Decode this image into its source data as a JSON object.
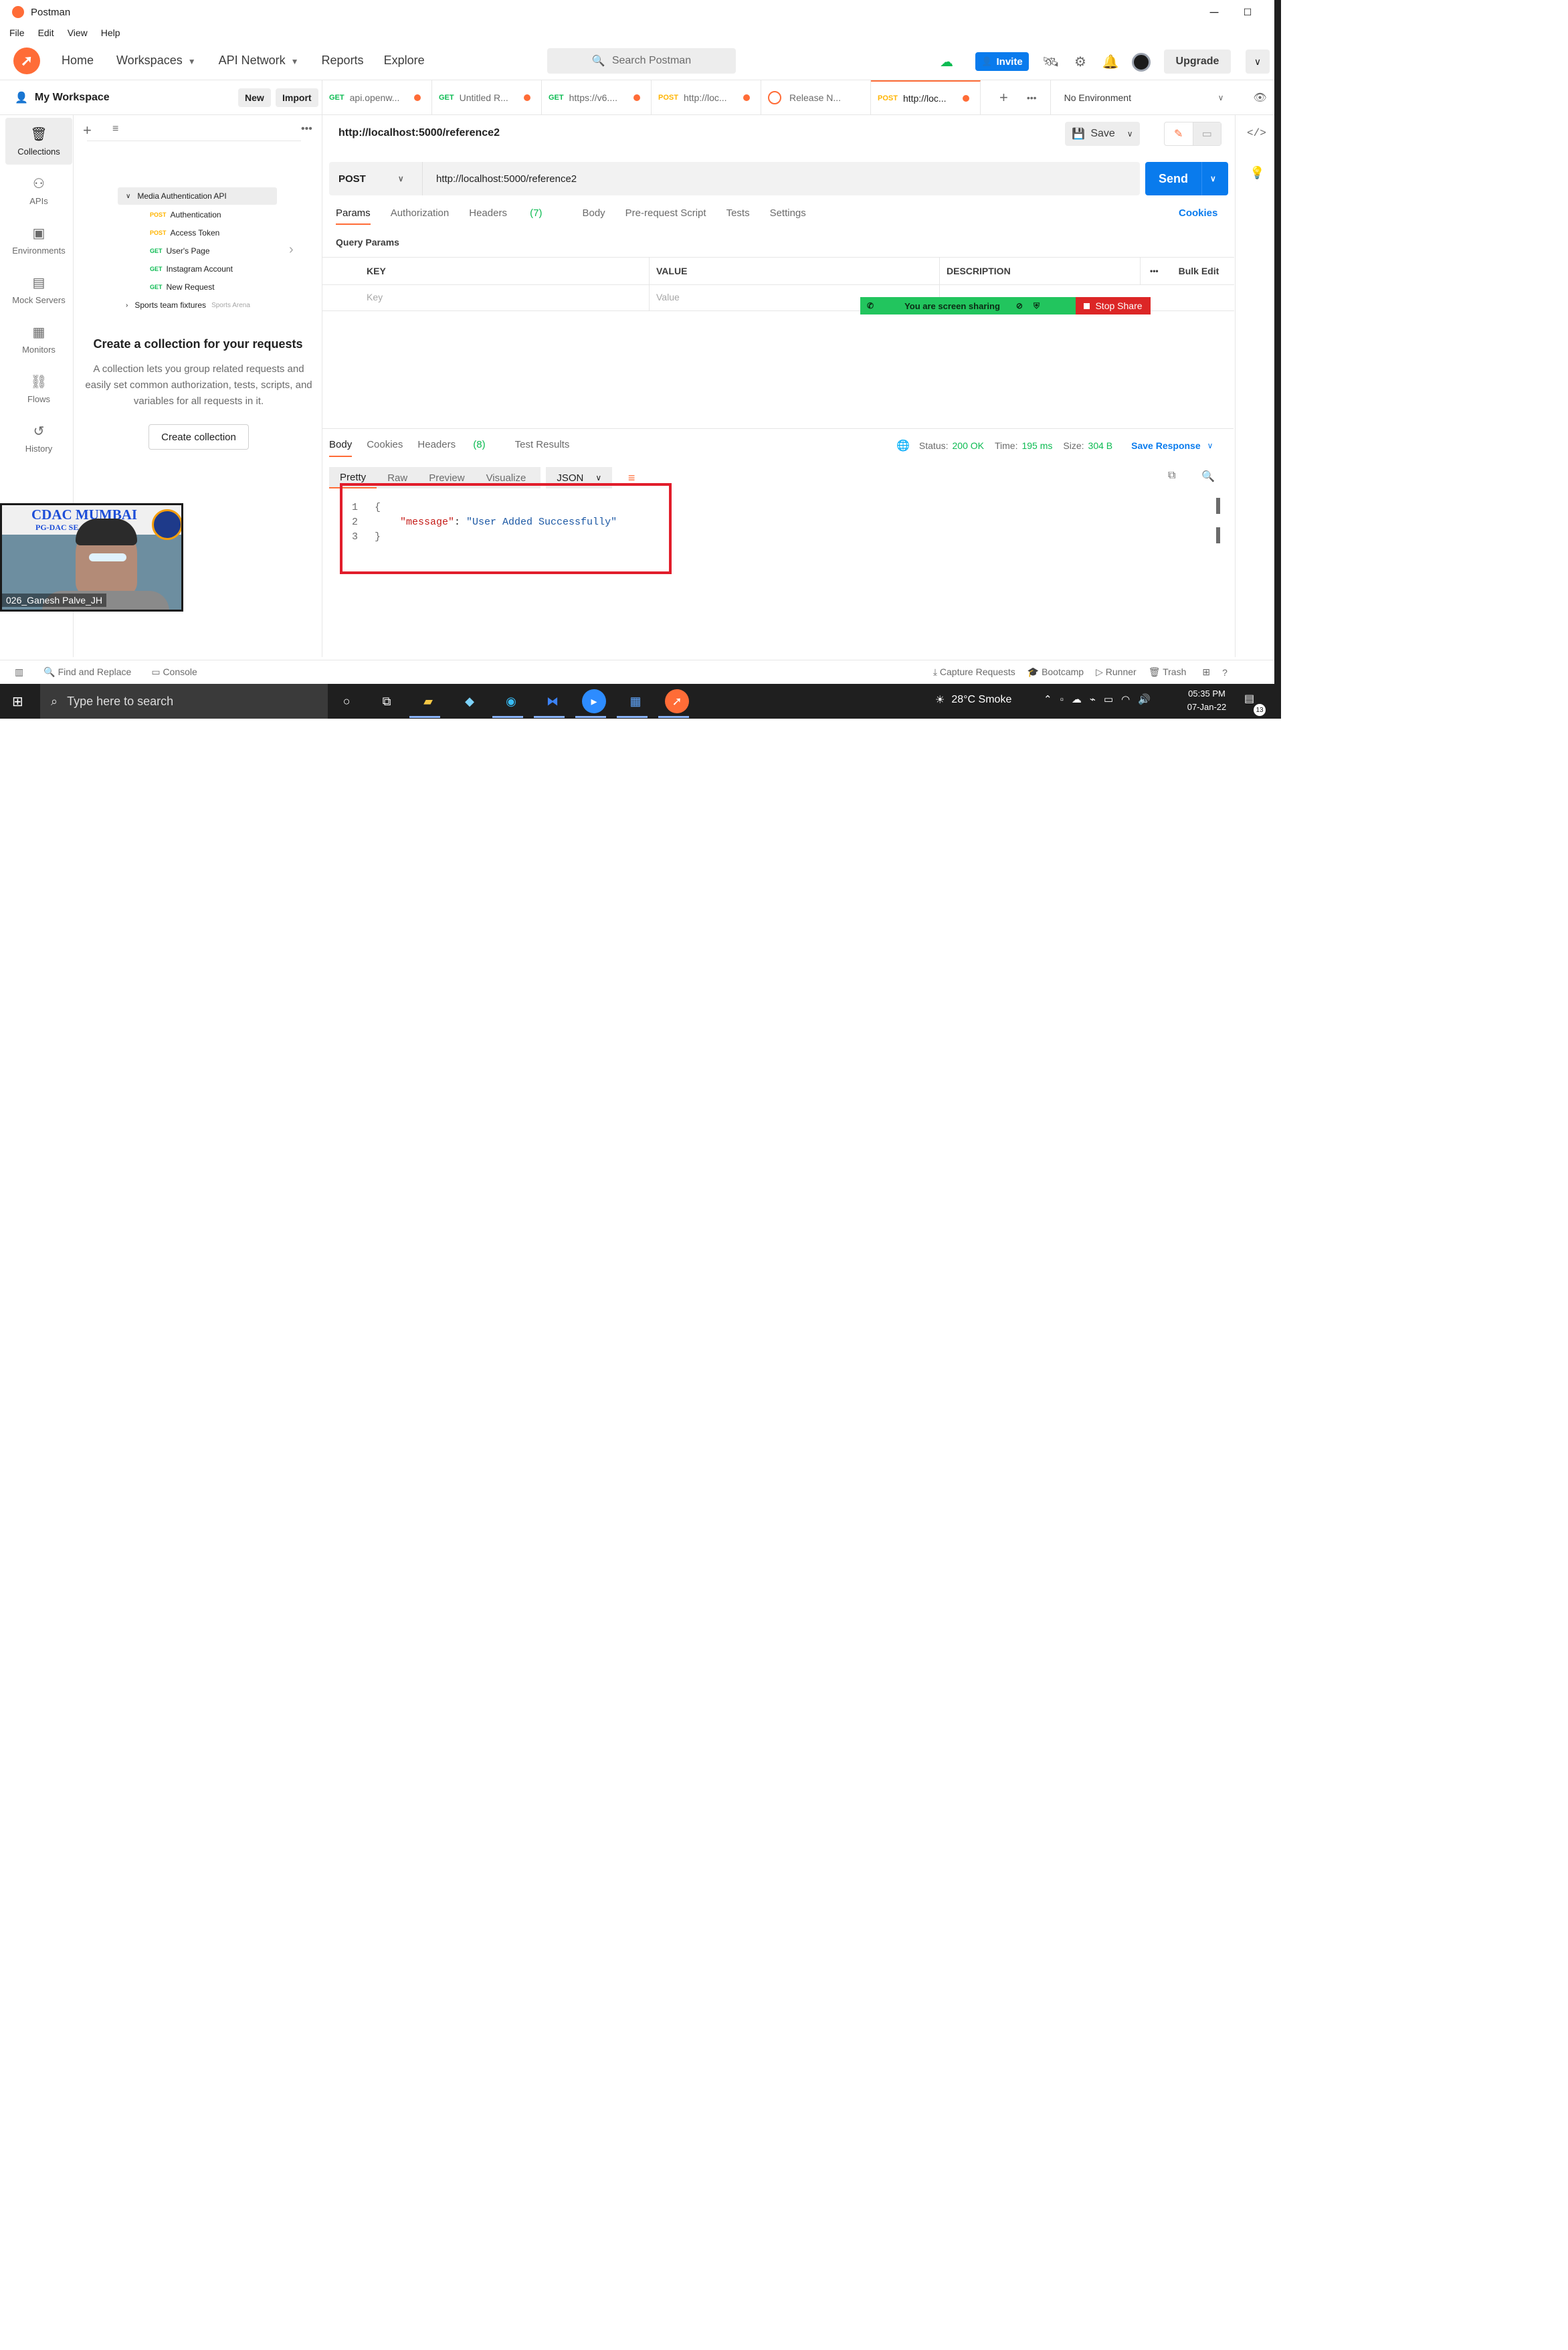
{
  "window": {
    "title": "Postman",
    "controls": [
      "─",
      "☐",
      "✕"
    ]
  },
  "menu": [
    "File",
    "Edit",
    "View",
    "Help"
  ],
  "header": {
    "nav": [
      {
        "label": "Home",
        "dropdown": false
      },
      {
        "label": "Workspaces",
        "dropdown": true
      },
      {
        "label": "API Network",
        "dropdown": true
      },
      {
        "label": "Reports",
        "dropdown": false
      },
      {
        "label": "Explore",
        "dropdown": false
      }
    ],
    "search_placeholder": "Search Postman",
    "invite_label": "Invite",
    "upgrade_label": "Upgrade"
  },
  "workspace": {
    "name": "My Workspace",
    "new_label": "New",
    "import_label": "Import"
  },
  "rail": [
    {
      "label": "Collections",
      "icon": "collections-icon",
      "active": true
    },
    {
      "label": "APIs",
      "icon": "apis-icon",
      "active": false
    },
    {
      "label": "Environments",
      "icon": "environments-icon",
      "active": false
    },
    {
      "label": "Mock Servers",
      "icon": "mock-servers-icon",
      "active": false
    },
    {
      "label": "Monitors",
      "icon": "monitors-icon",
      "active": false
    },
    {
      "label": "Flows",
      "icon": "flows-icon",
      "active": false
    },
    {
      "label": "History",
      "icon": "history-icon",
      "active": false
    }
  ],
  "illustration": {
    "folder": "Media Authentication API",
    "requests": [
      {
        "method": "POST",
        "name": "Authentication"
      },
      {
        "method": "POST",
        "name": "Access Token"
      },
      {
        "method": "GET",
        "name": "User's Page"
      },
      {
        "method": "GET",
        "name": "Instagram Account"
      },
      {
        "method": "GET",
        "name": "New Request"
      }
    ],
    "second_folder": "Sports team fixtures",
    "second_folder_note": "Sports Arena"
  },
  "empty_state": {
    "title": "Create a collection for your requests",
    "description": "A collection lets you group related requests and easily set common authorization, tests, scripts, and variables for all requests in it.",
    "button": "Create collection"
  },
  "tabs": [
    {
      "method": "GET",
      "label": "api.openw...",
      "dot": true,
      "active": false
    },
    {
      "method": "GET",
      "label": "Untitled R...",
      "dot": true,
      "active": false
    },
    {
      "method": "GET",
      "label": "https://v6....",
      "dot": true,
      "active": false
    },
    {
      "method": "POST",
      "label": "http://loc...",
      "dot": true,
      "active": false
    },
    {
      "method": "",
      "label": "Release N...",
      "dot": false,
      "active": false
    },
    {
      "method": "POST",
      "label": "http://loc...",
      "dot": true,
      "active": true
    }
  ],
  "environment": {
    "label": "No Environment"
  },
  "request": {
    "title": "http://localhost:5000/reference2",
    "save_label": "Save",
    "method": "POST",
    "url": "http://localhost:5000/reference2",
    "send_label": "Send",
    "tabs": [
      "Params",
      "Authorization",
      "Headers",
      "Body",
      "Pre-request Script",
      "Tests",
      "Settings"
    ],
    "headers_count": "(7)",
    "cookies_label": "Cookies",
    "query_params_label": "Query Params",
    "table": {
      "columns": [
        "KEY",
        "VALUE",
        "DESCRIPTION"
      ],
      "bulk_edit": "Bulk Edit",
      "placeholder_key": "Key",
      "placeholder_value": "Value"
    }
  },
  "screen_share": {
    "text": "You are screen sharing",
    "stop_label": "Stop Share"
  },
  "response": {
    "tabs": [
      "Body",
      "Cookies",
      "Headers",
      "Test Results"
    ],
    "headers_count": "(8)",
    "status_label": "Status:",
    "status_value": "200 OK",
    "time_label": "Time:",
    "time_value": "195 ms",
    "size_label": "Size:",
    "size_value": "304 B",
    "save_response": "Save Response",
    "format_tabs": [
      "Pretty",
      "Raw",
      "Preview",
      "Visualize"
    ],
    "format": "JSON",
    "code_lines": [
      "1",
      "2",
      "3"
    ],
    "brace_open": "{",
    "brace_close": "}",
    "json_key": "\"message\"",
    "json_colon": ": ",
    "json_value": "\"User Added Successfully\""
  },
  "statusbar": {
    "find_replace": "Find and Replace",
    "console": "Console",
    "capture": "Capture Requests",
    "bootcamp": "Bootcamp",
    "runner": "Runner",
    "trash": "Trash"
  },
  "video": {
    "banner": "CDAC MUMBAI",
    "subbanner": "PG-DAC SE",
    "name": "026_Ganesh Palve_JH"
  },
  "taskbar": {
    "search_placeholder": "Type here to search",
    "weather": "28°C  Smoke",
    "time": "05:35 PM",
    "date": "07-Jan-22",
    "notifications": "13"
  },
  "colors": {
    "accent": "#ff6c37",
    "primary": "#097bed",
    "get": "#0cbb52",
    "post": "#ffb400",
    "highlight": "#e11d2b"
  }
}
